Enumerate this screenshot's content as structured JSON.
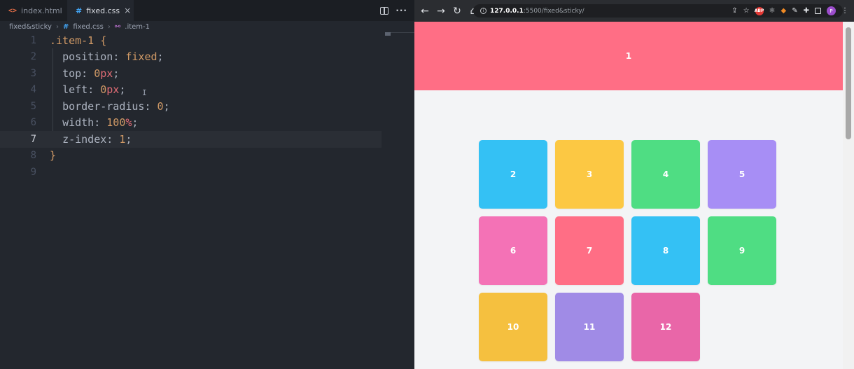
{
  "editor": {
    "tabs": [
      {
        "label": "index.html",
        "icon": "html-icon"
      },
      {
        "label": "fixed.css",
        "icon": "css-icon",
        "active": true
      }
    ],
    "close_glyph": "×",
    "breadcrumb": {
      "folder": "fixed&sticky",
      "file": "fixed.css",
      "symbol": ".item-1"
    },
    "line_numbers": [
      "1",
      "2",
      "3",
      "4",
      "5",
      "6",
      "7",
      "8",
      "9"
    ],
    "current_line": "7",
    "code": {
      "selector": ".item-1",
      "open_brace": "{",
      "close_brace": "}",
      "decls": [
        {
          "prop": "position",
          "value": "fixed",
          "unit": ""
        },
        {
          "prop": "top",
          "value": "0",
          "unit": "px"
        },
        {
          "prop": "left",
          "value": "0",
          "unit": "px"
        },
        {
          "prop": "border-radius",
          "value": "0",
          "unit": ""
        },
        {
          "prop": "width",
          "value": "100",
          "unit": "%"
        },
        {
          "prop": "z-index",
          "value": "1",
          "unit": ""
        }
      ]
    }
  },
  "browser": {
    "url_host": "127.0.0.1",
    "url_path": ":5500/fixed&sticky/",
    "ext_abp": "ABP",
    "profile_initial": "P",
    "header_item": {
      "label": "1",
      "color": "#ff6e85"
    },
    "items": [
      {
        "label": "2",
        "color": "#34c1f4"
      },
      {
        "label": "3",
        "color": "#fcc843"
      },
      {
        "label": "4",
        "color": "#4fdd83"
      },
      {
        "label": "5",
        "color": "#a78ef5"
      },
      {
        "label": "6",
        "color": "#f472b6"
      },
      {
        "label": "7",
        "color": "#ff6e85"
      },
      {
        "label": "8",
        "color": "#34c1f4"
      },
      {
        "label": "9",
        "color": "#4fdd83"
      },
      {
        "label": "10",
        "color": "#f5c03f"
      },
      {
        "label": "11",
        "color": "#a08be6"
      },
      {
        "label": "12",
        "color": "#e966a8"
      }
    ]
  }
}
